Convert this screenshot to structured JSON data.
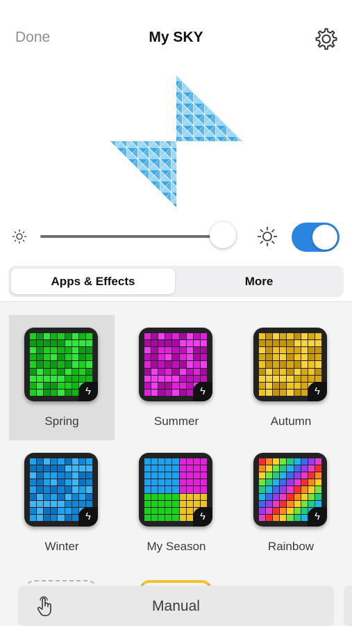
{
  "nav": {
    "done_label": "Done",
    "title": "My SKY",
    "settings_icon": "gear-icon"
  },
  "brightness": {
    "level_percent": 94,
    "power_on": true
  },
  "segments": [
    {
      "label": "Apps & Effects",
      "active": true
    },
    {
      "label": "More",
      "active": false
    }
  ],
  "effects": [
    {
      "label": "Spring",
      "selected": true,
      "palette": [
        "#19d31b",
        "#0fb80f",
        "#2ee83a",
        "#0a9c12"
      ]
    },
    {
      "label": "Summer",
      "selected": false,
      "palette": [
        "#e51ee0",
        "#c10fbf",
        "#f23cf0",
        "#a70a9f"
      ]
    },
    {
      "label": "Autumn",
      "selected": false,
      "palette": [
        "#f0c419",
        "#d8a90c",
        "#f7d43a",
        "#c59408"
      ]
    },
    {
      "label": "Winter",
      "selected": false,
      "palette": [
        "#1aa3f0",
        "#0d86d8",
        "#3bb6f7",
        "#0a73c2"
      ]
    },
    {
      "label": "My Season",
      "selected": false,
      "quadrants": [
        "#1aa3f0",
        "#e51ee0",
        "#19d31b",
        "#f0c419"
      ]
    },
    {
      "label": "Rainbow",
      "selected": false
    }
  ],
  "manual": {
    "label": "Manual",
    "icon": "touch-hand-icon"
  },
  "colors": {
    "accent": "#2a84e0",
    "tile_selected": "#dedede",
    "gallery_bg": "#f4f4f4"
  }
}
